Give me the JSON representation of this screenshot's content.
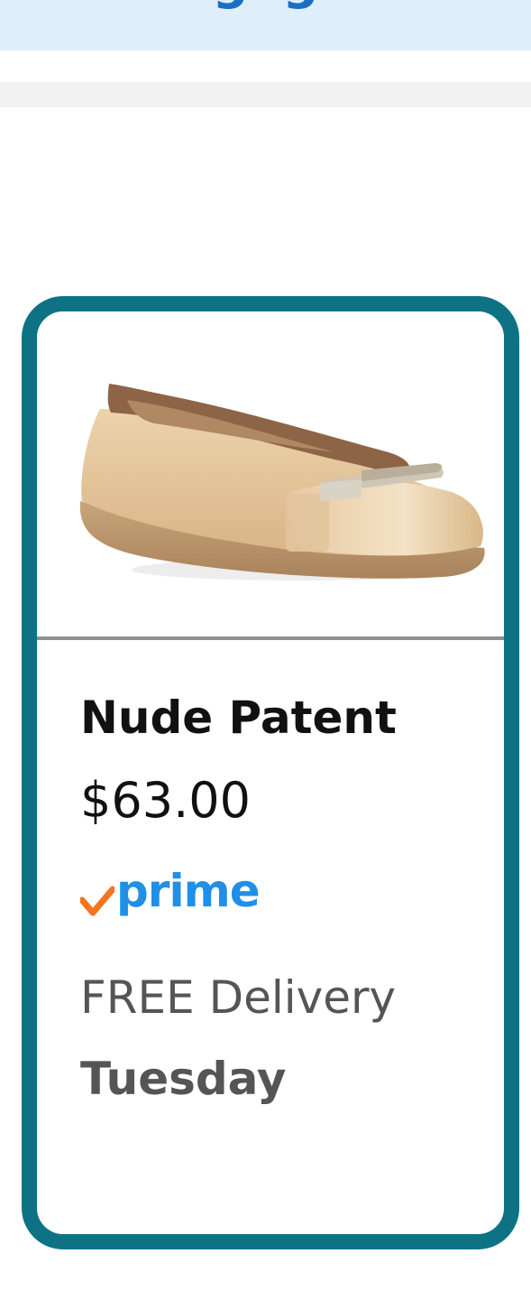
{
  "product": {
    "title": "Nude Patent",
    "price": "$63.00",
    "prime_label": "prime",
    "delivery_label": "FREE Delivery",
    "delivery_day": "Tuesday",
    "image_icon": "shoe-image"
  },
  "colors": {
    "card_border": "#0e7285",
    "banner_bg": "#dfeefb",
    "prime_blue": "#1f8fe8",
    "prime_check": "#f3751f",
    "divider": "#8c9193"
  }
}
